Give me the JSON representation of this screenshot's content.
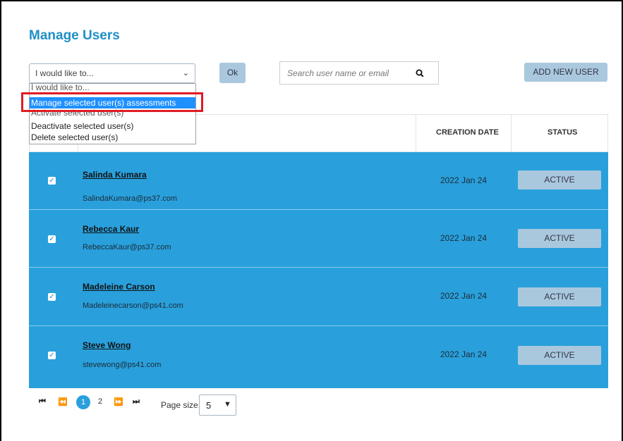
{
  "page": {
    "title": "Manage Users"
  },
  "toolbar": {
    "action_select_value": "I would like to...",
    "ok_label": "Ok",
    "search_placeholder": "Search user name or email",
    "add_user_label": "ADD NEW USER"
  },
  "dropdown": {
    "options": [
      "I would like to...",
      "Manage selected user(s) assessments",
      "Activate selected user(s)",
      "Deactivate selected user(s)",
      "Delete selected user(s)"
    ],
    "highlighted_index": 1
  },
  "table": {
    "columns": [
      "CREATION DATE",
      "STATUS"
    ],
    "rows": [
      {
        "name": "Salinda Kumara",
        "email": "SalindaKumara@ps37.com",
        "date": "2022 Jan 24",
        "status": "ACTIVE",
        "checked": true
      },
      {
        "name": "Rebecca Kaur",
        "email": "RebeccaKaur@ps37.com",
        "date": "2022 Jan 24",
        "status": "ACTIVE",
        "checked": true
      },
      {
        "name": "Madeleine Carson",
        "email": "Madeleinecarson@ps41.com",
        "date": "2022 Jan 24",
        "status": "ACTIVE",
        "checked": true
      },
      {
        "name": "Steve Wong",
        "email": "stevewong@ps41.com",
        "date": "2022 Jan 24",
        "status": "ACTIVE",
        "checked": true
      }
    ]
  },
  "pagination": {
    "first_icon": "⏮",
    "prev_icon": "⏪",
    "current_page": "1",
    "next_page": "2",
    "next_icon": "⏩",
    "last_icon": "⏭",
    "page_size_label": "Page size:",
    "page_size_value": "5"
  },
  "colors": {
    "accent": "#1f8fc7",
    "row_selected": "#29a0dc",
    "button": "#a9c8de",
    "highlight": "#e01b24"
  }
}
